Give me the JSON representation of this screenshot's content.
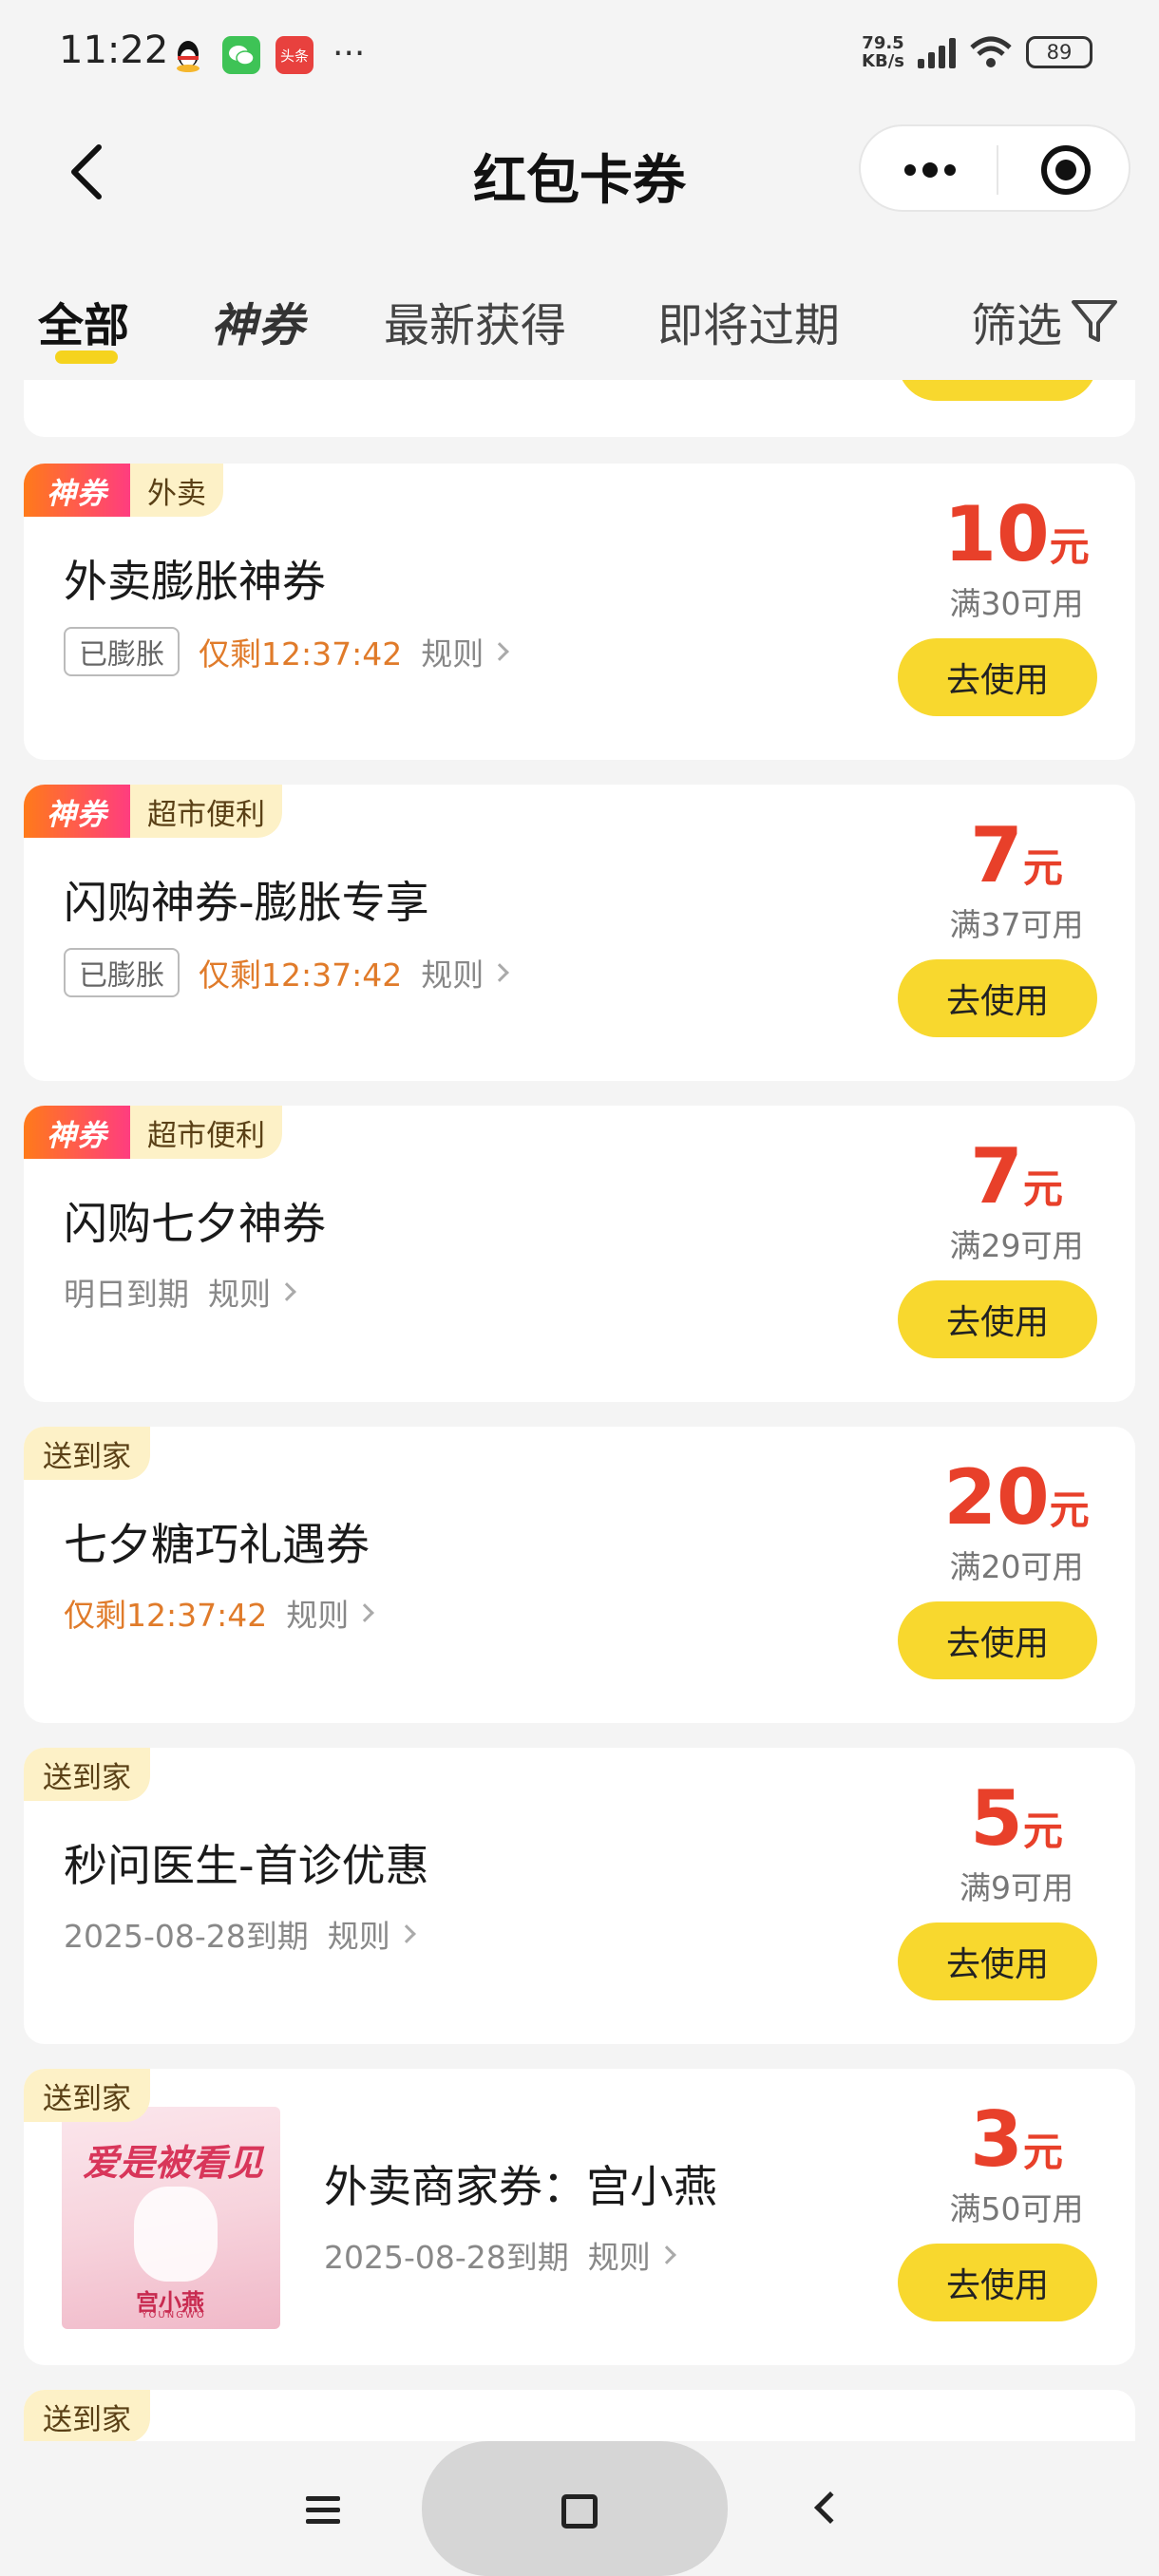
{
  "status_bar": {
    "time": "11:22",
    "apps": [
      {
        "icon": "qq-icon",
        "color": "#ffffff",
        "label": ""
      },
      {
        "icon": "wechat-icon",
        "color": "#3ec356",
        "label": ""
      },
      {
        "icon": "toutiao-icon",
        "color": "#e8413e",
        "label": "头条"
      }
    ],
    "more": "···",
    "net_speed_value": "79.5",
    "net_speed_unit": "KB/s",
    "battery": "89"
  },
  "nav": {
    "title": "红包卡券"
  },
  "tabs": {
    "all": "全部",
    "shen": "神券",
    "latest": "最新获得",
    "expiring": "即将过期",
    "filter": "筛选"
  },
  "coupons": [
    {
      "shen_tag": "神券",
      "category": "外卖",
      "title": "外卖膨胀神券",
      "badge": "已膨胀",
      "countdown": "仅剩12:37:42",
      "expiry": "",
      "rule": "规则",
      "amount": "10",
      "unit": "元",
      "condition": "满30可用",
      "button": "去使用"
    },
    {
      "shen_tag": "神券",
      "category": "超市便利",
      "title": "闪购神券-膨胀专享",
      "badge": "已膨胀",
      "countdown": "仅剩12:37:42",
      "expiry": "",
      "rule": "规则",
      "amount": "7",
      "unit": "元",
      "condition": "满37可用",
      "button": "去使用"
    },
    {
      "shen_tag": "神券",
      "category": "超市便利",
      "title": "闪购七夕神券",
      "badge": "",
      "countdown": "",
      "expiry": "明日到期",
      "rule": "规则",
      "amount": "7",
      "unit": "元",
      "condition": "满29可用",
      "button": "去使用"
    },
    {
      "shen_tag": "",
      "category": "送到家",
      "title": "七夕糖巧礼遇券",
      "badge": "",
      "countdown": "仅剩12:37:42",
      "expiry": "",
      "rule": "规则",
      "amount": "20",
      "unit": "元",
      "condition": "满20可用",
      "button": "去使用"
    },
    {
      "shen_tag": "",
      "category": "送到家",
      "title": "秒问医生-首诊优惠",
      "badge": "",
      "countdown": "",
      "expiry": "2025-08-28到期",
      "rule": "规则",
      "amount": "5",
      "unit": "元",
      "condition": "满9可用",
      "button": "去使用"
    },
    {
      "shen_tag": "",
      "category": "送到家",
      "title": "外卖商家券：宫小燕",
      "badge": "",
      "countdown": "",
      "expiry": "2025-08-28到期",
      "rule": "规则",
      "amount": "3",
      "unit": "元",
      "condition": "满50可用",
      "button": "去使用",
      "thumb": {
        "headline": "爱是被看见",
        "brand": "宫小燕",
        "brand_en": "YOUNGWO"
      }
    },
    {
      "shen_tag": "",
      "category": "送到家"
    }
  ]
}
